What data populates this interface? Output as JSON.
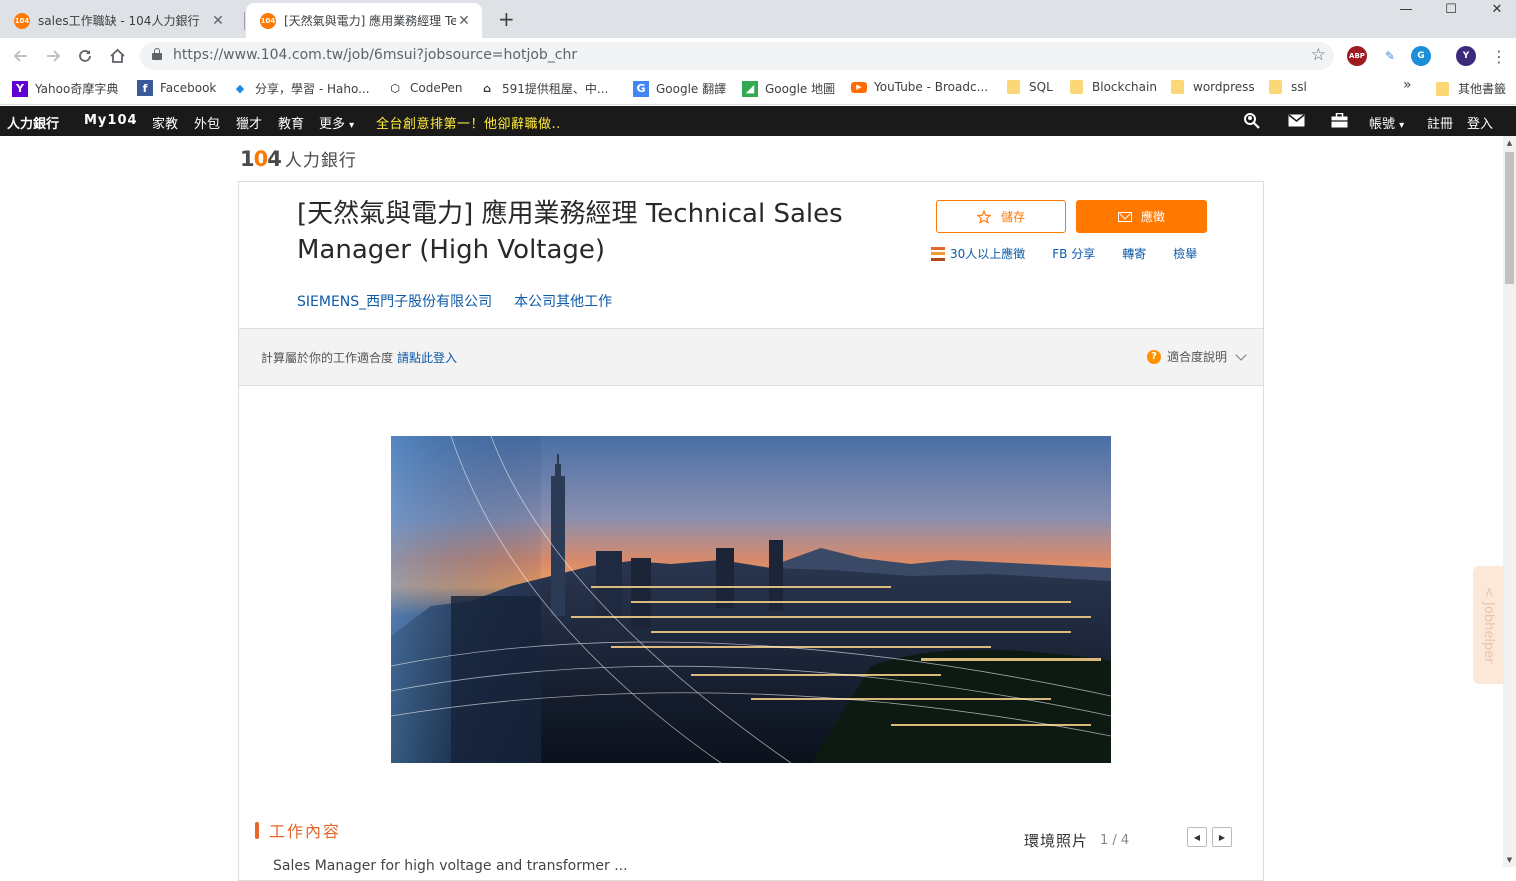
{
  "browser": {
    "tabs": [
      {
        "favicon": "104",
        "title": "sales工作職缺 - 104人力銀行",
        "close": "✕",
        "active": false
      },
      {
        "favicon": "104",
        "title": "[天然氣與電力] 應用業務經理 Te",
        "close": "✕",
        "active": true
      }
    ],
    "new_tab": "+",
    "window_controls": {
      "minimize": "—",
      "maximize": "☐",
      "close": "✕"
    },
    "url": "https://www.104.com.tw/job/6msui?jobsource=hotjob_chr",
    "extensions": [
      "ABP",
      "G",
      "Y"
    ],
    "bookmarks": [
      {
        "label": "Yahoo奇摩字典",
        "icon": "yahoo-icon"
      },
      {
        "label": "Facebook",
        "icon": "facebook-icon"
      },
      {
        "label": "分享，學習 - Haho...",
        "icon": "hahow-icon"
      },
      {
        "label": "CodePen",
        "icon": "codepen-icon"
      },
      {
        "label": "591提供租屋、中...",
        "icon": "house-icon"
      },
      {
        "label": "Google 翻譯",
        "icon": "google-translate-icon"
      },
      {
        "label": "Google 地圖",
        "icon": "google-maps-icon"
      },
      {
        "label": "YouTube - Broadc...",
        "icon": "youtube-icon"
      },
      {
        "label": "SQL",
        "icon": "folder-icon"
      },
      {
        "label": "Blockchain",
        "icon": "folder-icon"
      },
      {
        "label": "wordpress",
        "icon": "folder-icon"
      },
      {
        "label": "ssl",
        "icon": "folder-icon"
      }
    ],
    "bookmarks_overflow": "»",
    "other_bookmarks": "其他書籤"
  },
  "sitenav": {
    "brand": "人力銀行",
    "items": [
      "My104",
      "家教",
      "外包",
      "獵才",
      "教育",
      "更多"
    ],
    "more_caret": "▾",
    "promo": "全台創意排第一！他卻辭職做..",
    "right": {
      "account": "帳號",
      "account_caret": "▾",
      "register": "註冊",
      "login": "登入"
    }
  },
  "logo": {
    "number_a": "1",
    "number_o": "0",
    "number_b": "4",
    "text": "人力銀行"
  },
  "job": {
    "title": "[天然氣與電力] 應用業務經理 Technical Sales Manager (High Voltage)",
    "company": "SIEMENS_西門子股份有限公司",
    "other_jobs": "本公司其他工作",
    "save_label": "儲存",
    "apply_label": "應徵",
    "applicants": "30人以上應徵",
    "fb_share": "FB 分享",
    "forward": "轉寄",
    "report": "檢舉"
  },
  "fit": {
    "label": "計算屬於你的工作適合度",
    "login_link": "請點此登入",
    "help": "適合度說明",
    "help_icon": "?"
  },
  "content": {
    "section_title": "工作內容",
    "photos_title": "環境照片",
    "photos_page": "1 / 4",
    "prev": "◀",
    "next": "▶",
    "description_start": "Sales Manager for high voltage and transformer ...",
    "jobhelper": "Jobhelper",
    "jobhelper_arrow": "<"
  },
  "colors": {
    "accent": "#ff7800",
    "link": "#0e5aa8",
    "section": "#e4672b",
    "nav_bg": "#1a1a1a",
    "promo": "#ffeb3b"
  }
}
